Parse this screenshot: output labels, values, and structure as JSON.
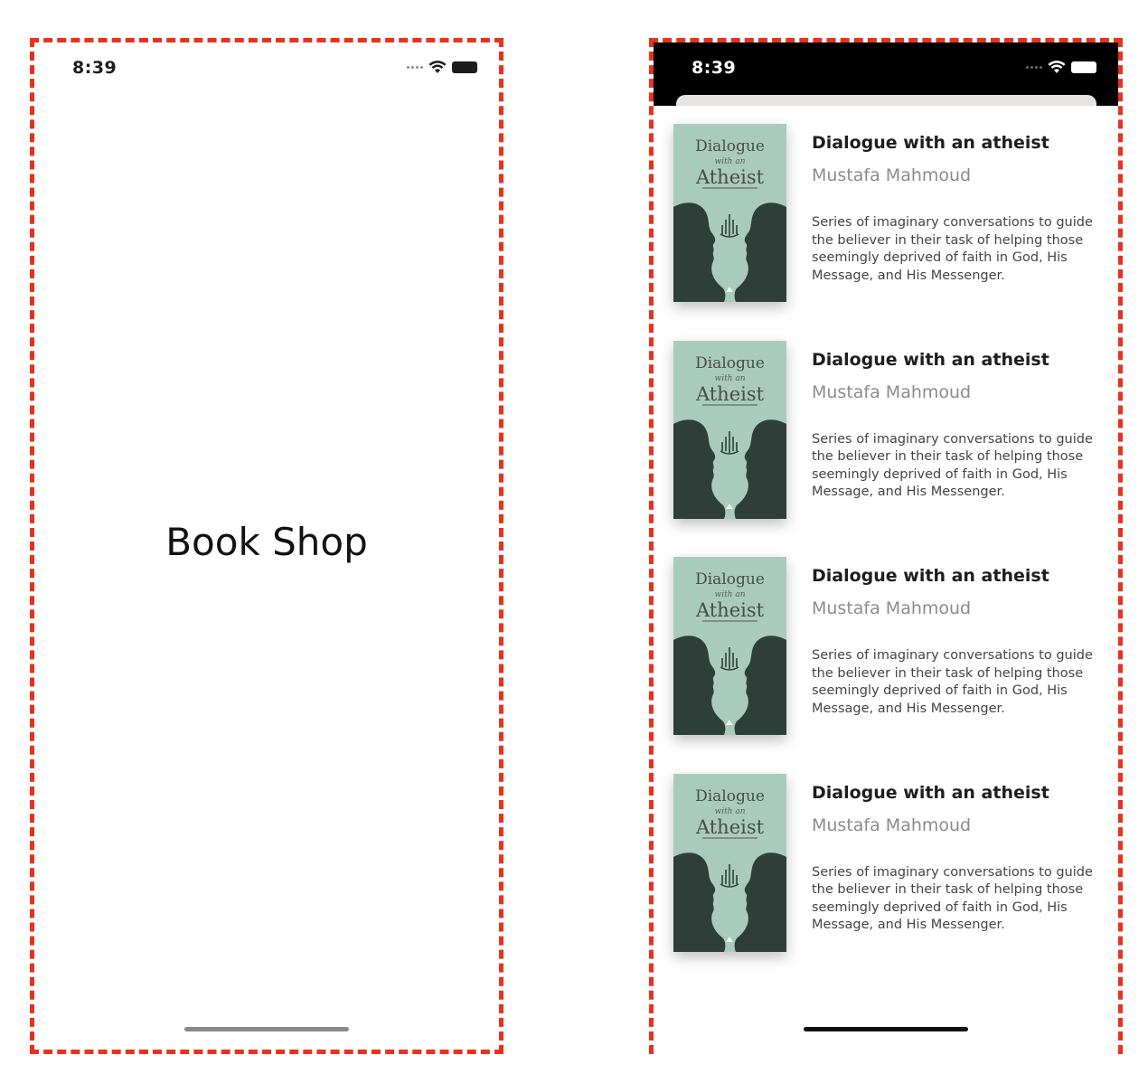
{
  "colors": {
    "frame_dash": "#e8321e",
    "status_icon_light": "#1d1d1d",
    "status_icon_dark": "#ffffff",
    "home_indicator_light": "#8a8a8a",
    "home_indicator_dark": "#111111",
    "cover_bg": "#a9cbbd",
    "cover_silhouette": "#2e3f3a",
    "cover_title": "#4a4a4a"
  },
  "splash": {
    "status_time": "8:39",
    "title": "Book Shop"
  },
  "list_screen": {
    "status_time": "8:39",
    "books": [
      {
        "title": "Dialogue with an atheist",
        "author": "Mustafa Mahmoud",
        "description": "Series of imaginary conversations to guide the believer in their task of helping those seemingly deprived of faith in God, His Message, and His Messenger.",
        "cover_line1": "Dialogue",
        "cover_line2": "with an",
        "cover_line3": "Atheist"
      },
      {
        "title": "Dialogue with an atheist",
        "author": "Mustafa Mahmoud",
        "description": "Series of imaginary conversations to guide the believer in their task of helping those seemingly deprived of faith in God, His Message, and His Messenger.",
        "cover_line1": "Dialogue",
        "cover_line2": "with an",
        "cover_line3": "Atheist"
      },
      {
        "title": "Dialogue with an atheist",
        "author": "Mustafa Mahmoud",
        "description": "Series of imaginary conversations to guide the believer in their task of helping those seemingly deprived of faith in God, His Message, and His Messenger.",
        "cover_line1": "Dialogue",
        "cover_line2": "with an",
        "cover_line3": "Atheist"
      },
      {
        "title": "Dialogue with an atheist",
        "author": "Mustafa Mahmoud",
        "description": "Series of imaginary conversations to guide the believer in their task of helping those seemingly deprived of faith in God, His Message, and His Messenger.",
        "cover_line1": "Dialogue",
        "cover_line2": "with an",
        "cover_line3": "Atheist"
      }
    ]
  }
}
